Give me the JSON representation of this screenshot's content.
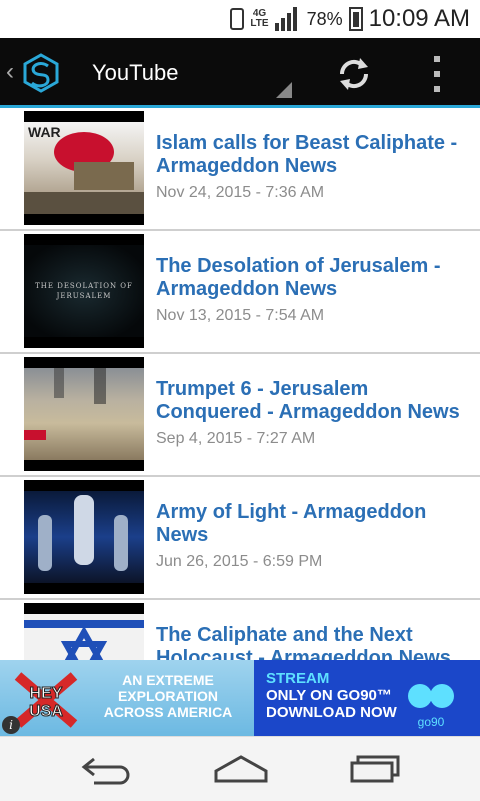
{
  "status_bar": {
    "network": "4G\nLTE",
    "battery_percent": "78%",
    "time": "10:09 AM"
  },
  "action_bar": {
    "title": "YouTube"
  },
  "videos": [
    {
      "title": "Islam calls for Beast Caliphate - Armageddon News",
      "date": "Nov 24, 2015 - 7:36 AM",
      "thumb_text": "WAR"
    },
    {
      "title": "The Desolation of Jerusalem - Armageddon News",
      "date": "Nov 13, 2015 - 7:54 AM",
      "thumb_text": "THE DESOLATION OF JERUSALEM"
    },
    {
      "title": "Trumpet 6 - Jerusalem Conquered - Armageddon News",
      "date": "Sep 4, 2015 - 7:27 AM",
      "thumb_text": ""
    },
    {
      "title": "Army of Light - Armageddon News",
      "date": "Jun 26, 2015 - 6:59 PM",
      "thumb_text": ""
    },
    {
      "title": "The Caliphate and the Next Holocaust - Armageddon News",
      "date": "",
      "thumb_text": ""
    }
  ],
  "ad": {
    "brand_left": "HEY USA",
    "left_text": "AN EXTREME EXPLORATION ACROSS AMERICA",
    "right_line1": "STREAM",
    "right_line2": "ONLY ON GO90™",
    "right_line3": "DOWNLOAD NOW",
    "brand_right": "go90",
    "info_glyph": "i"
  },
  "colors": {
    "accent": "#2aa8d8",
    "title_blue": "#2b6fb5",
    "date_gray": "#8c8c8c"
  }
}
